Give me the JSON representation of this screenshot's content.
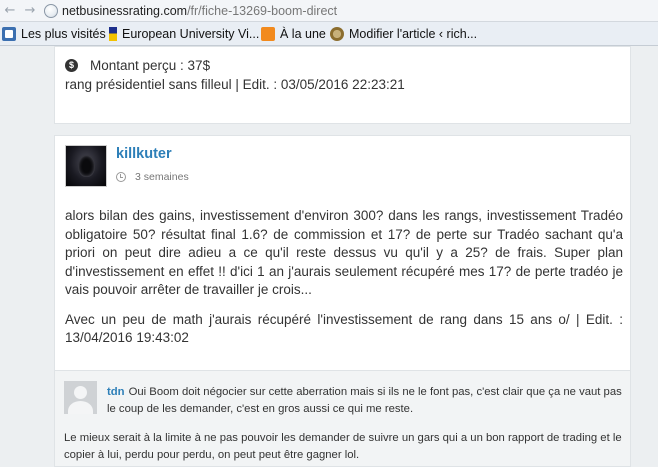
{
  "browser": {
    "url_host": "netbusinessrating.com",
    "url_path": "/fr/fiche-13269-boom-direct",
    "bookmarks": [
      {
        "label": "Les plus visités",
        "icon": "star-bookmark-icon"
      },
      {
        "label": "European University Vi...",
        "icon": "eu-flag-icon"
      },
      {
        "label": "À la une",
        "icon": "rss-icon"
      },
      {
        "label": "Modifier l'article ‹ rich...",
        "icon": "wordpress-icon"
      }
    ]
  },
  "previous_comment": {
    "amount_label": "Montant perçu : 37$",
    "rank_line": "rang présidentiel sans filleul | Edit. : 03/05/2016 22:23:21"
  },
  "comment": {
    "author": "killkuter",
    "time": "3 semaines",
    "paragraph1": "alors bilan des gains, investissement d'environ 300? dans les rangs, investissement Tradéo obligatoire 50? résultat final 1.6? de commission et 17? de perte sur Tradéo sachant qu'a priori on peut dire adieu a ce qu'il reste dessus vu qu'il y a 25? de frais. Super plan d'investissement en effet !! d'ici 1 an j'aurais seulement récupéré mes 17? de perte tradéo je vais pouvoir arrêter de travailler je crois...",
    "paragraph2": "Avec un peu de math j'aurais récupéré l'investissement de rang dans 15 ans o/ | Edit. : 13/04/2016 19:43:02"
  },
  "reply": {
    "author": "tdn",
    "text1": "Oui Boom doit négocier sur cette aberration mais si ils ne le font pas, c'est clair que ça ne vaut pas le coup de les demander, c'est en gros aussi ce qui me reste.",
    "text2": "Le mieux serait à la limite à ne pas pouvoir les demander de suivre un gars qui a un bon rapport de trading et le copier à lui, perdu pour perdu, on peut peut être gagner lol."
  }
}
